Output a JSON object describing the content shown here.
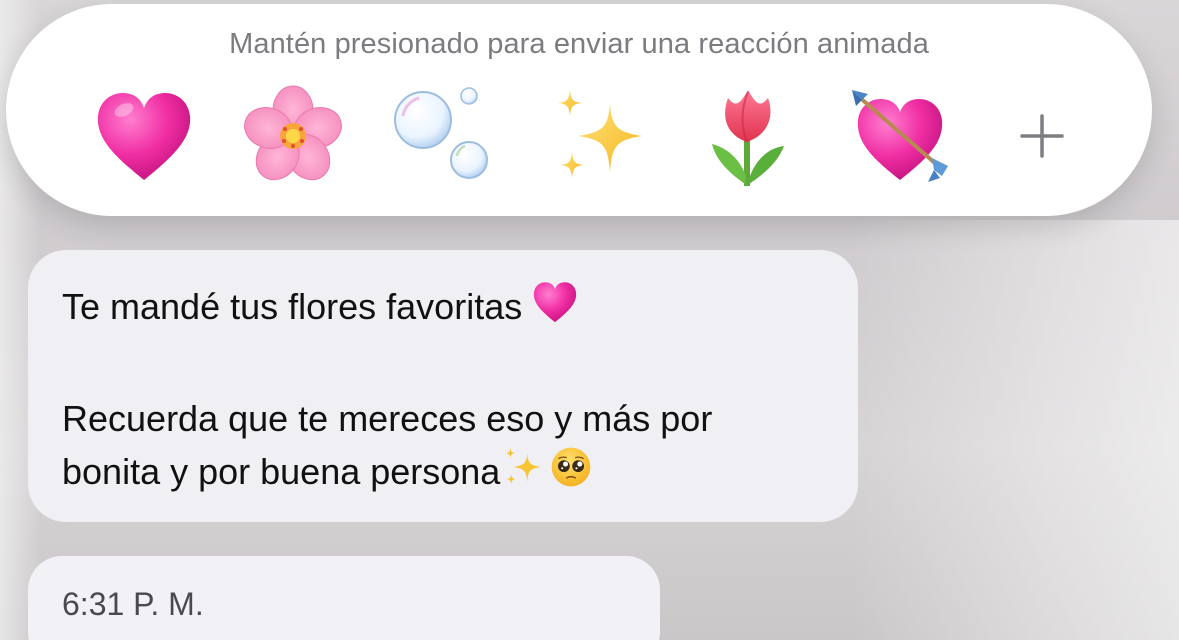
{
  "reaction_bar": {
    "hint": "Mantén presionado para enviar una reacción animada",
    "reactions": [
      {
        "name": "heart"
      },
      {
        "name": "cherry-blossom"
      },
      {
        "name": "bubbles"
      },
      {
        "name": "sparkles"
      },
      {
        "name": "tulip"
      },
      {
        "name": "heart-with-arrow"
      },
      {
        "name": "plus"
      }
    ]
  },
  "message": {
    "line1": "Te mandé tus flores favoritas",
    "line2": "Recuerda que te mereces eso y más por",
    "line3": "bonita y por buena persona",
    "line1_emoji": "heart-icon",
    "line3_emojis": [
      "sparkles-icon",
      "pleading-face-icon"
    ]
  },
  "timestamp": {
    "time": "6:31 P. M."
  },
  "colors": {
    "panel": "#ffffff",
    "bubble": "#efeff4",
    "hint_text": "#7b7b80",
    "heart": "#ee2a9e",
    "accent_gold": "#f7c531"
  }
}
